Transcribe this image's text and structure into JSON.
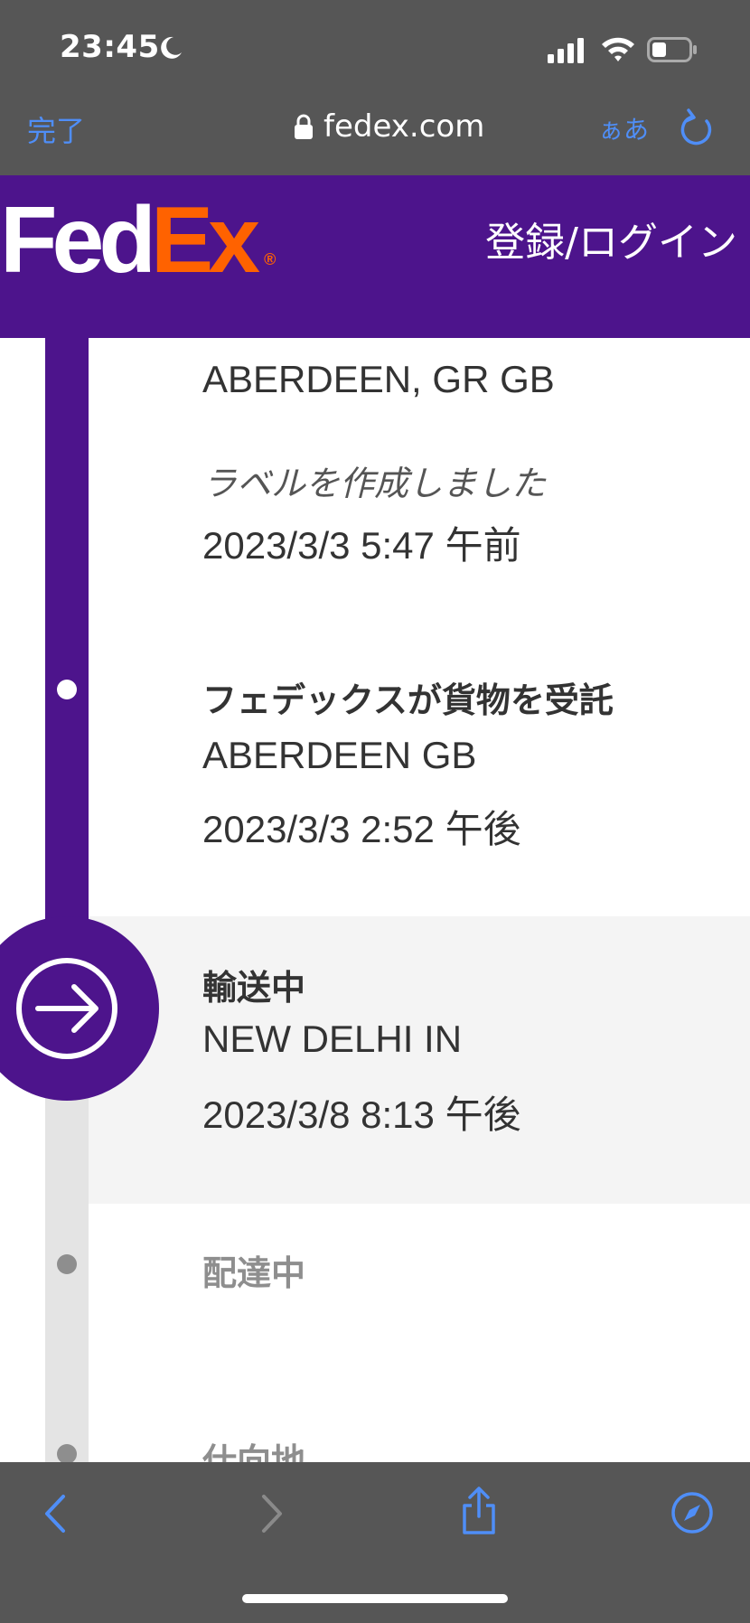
{
  "status_bar": {
    "time": "23:45",
    "icons": [
      "moon-icon",
      "signal-icon",
      "wifi-icon",
      "battery-icon"
    ]
  },
  "browser": {
    "done_label": "完了",
    "url": "fedex.com",
    "text_size_label": "ぁあ",
    "icons": [
      "lock-icon",
      "reload-icon"
    ]
  },
  "header": {
    "logo_fed": "Fed",
    "logo_ex": "Ex",
    "logo_reg": "®",
    "login_label": "登録/ログイン",
    "colors": {
      "brand_purple": "#4d148c",
      "brand_orange": "#ff6200"
    }
  },
  "timeline": {
    "events": [
      {
        "location": "ABERDEEN, GR GB",
        "status": "ラベルを作成しました",
        "datetime": "2023/3/3 5:47 午前"
      },
      {
        "status": "フェデックスが貨物を受託",
        "location": "ABERDEEN GB",
        "datetime": "2023/3/3 2:52 午後"
      },
      {
        "status": "輸送中",
        "location": "NEW DELHI IN",
        "datetime": "2023/3/8 8:13 午後",
        "current": true
      },
      {
        "status": "配達中"
      },
      {
        "status": "仕向地"
      }
    ]
  },
  "toolbar": {
    "icons": [
      "back-icon",
      "forward-icon",
      "share-icon",
      "compass-icon"
    ]
  }
}
